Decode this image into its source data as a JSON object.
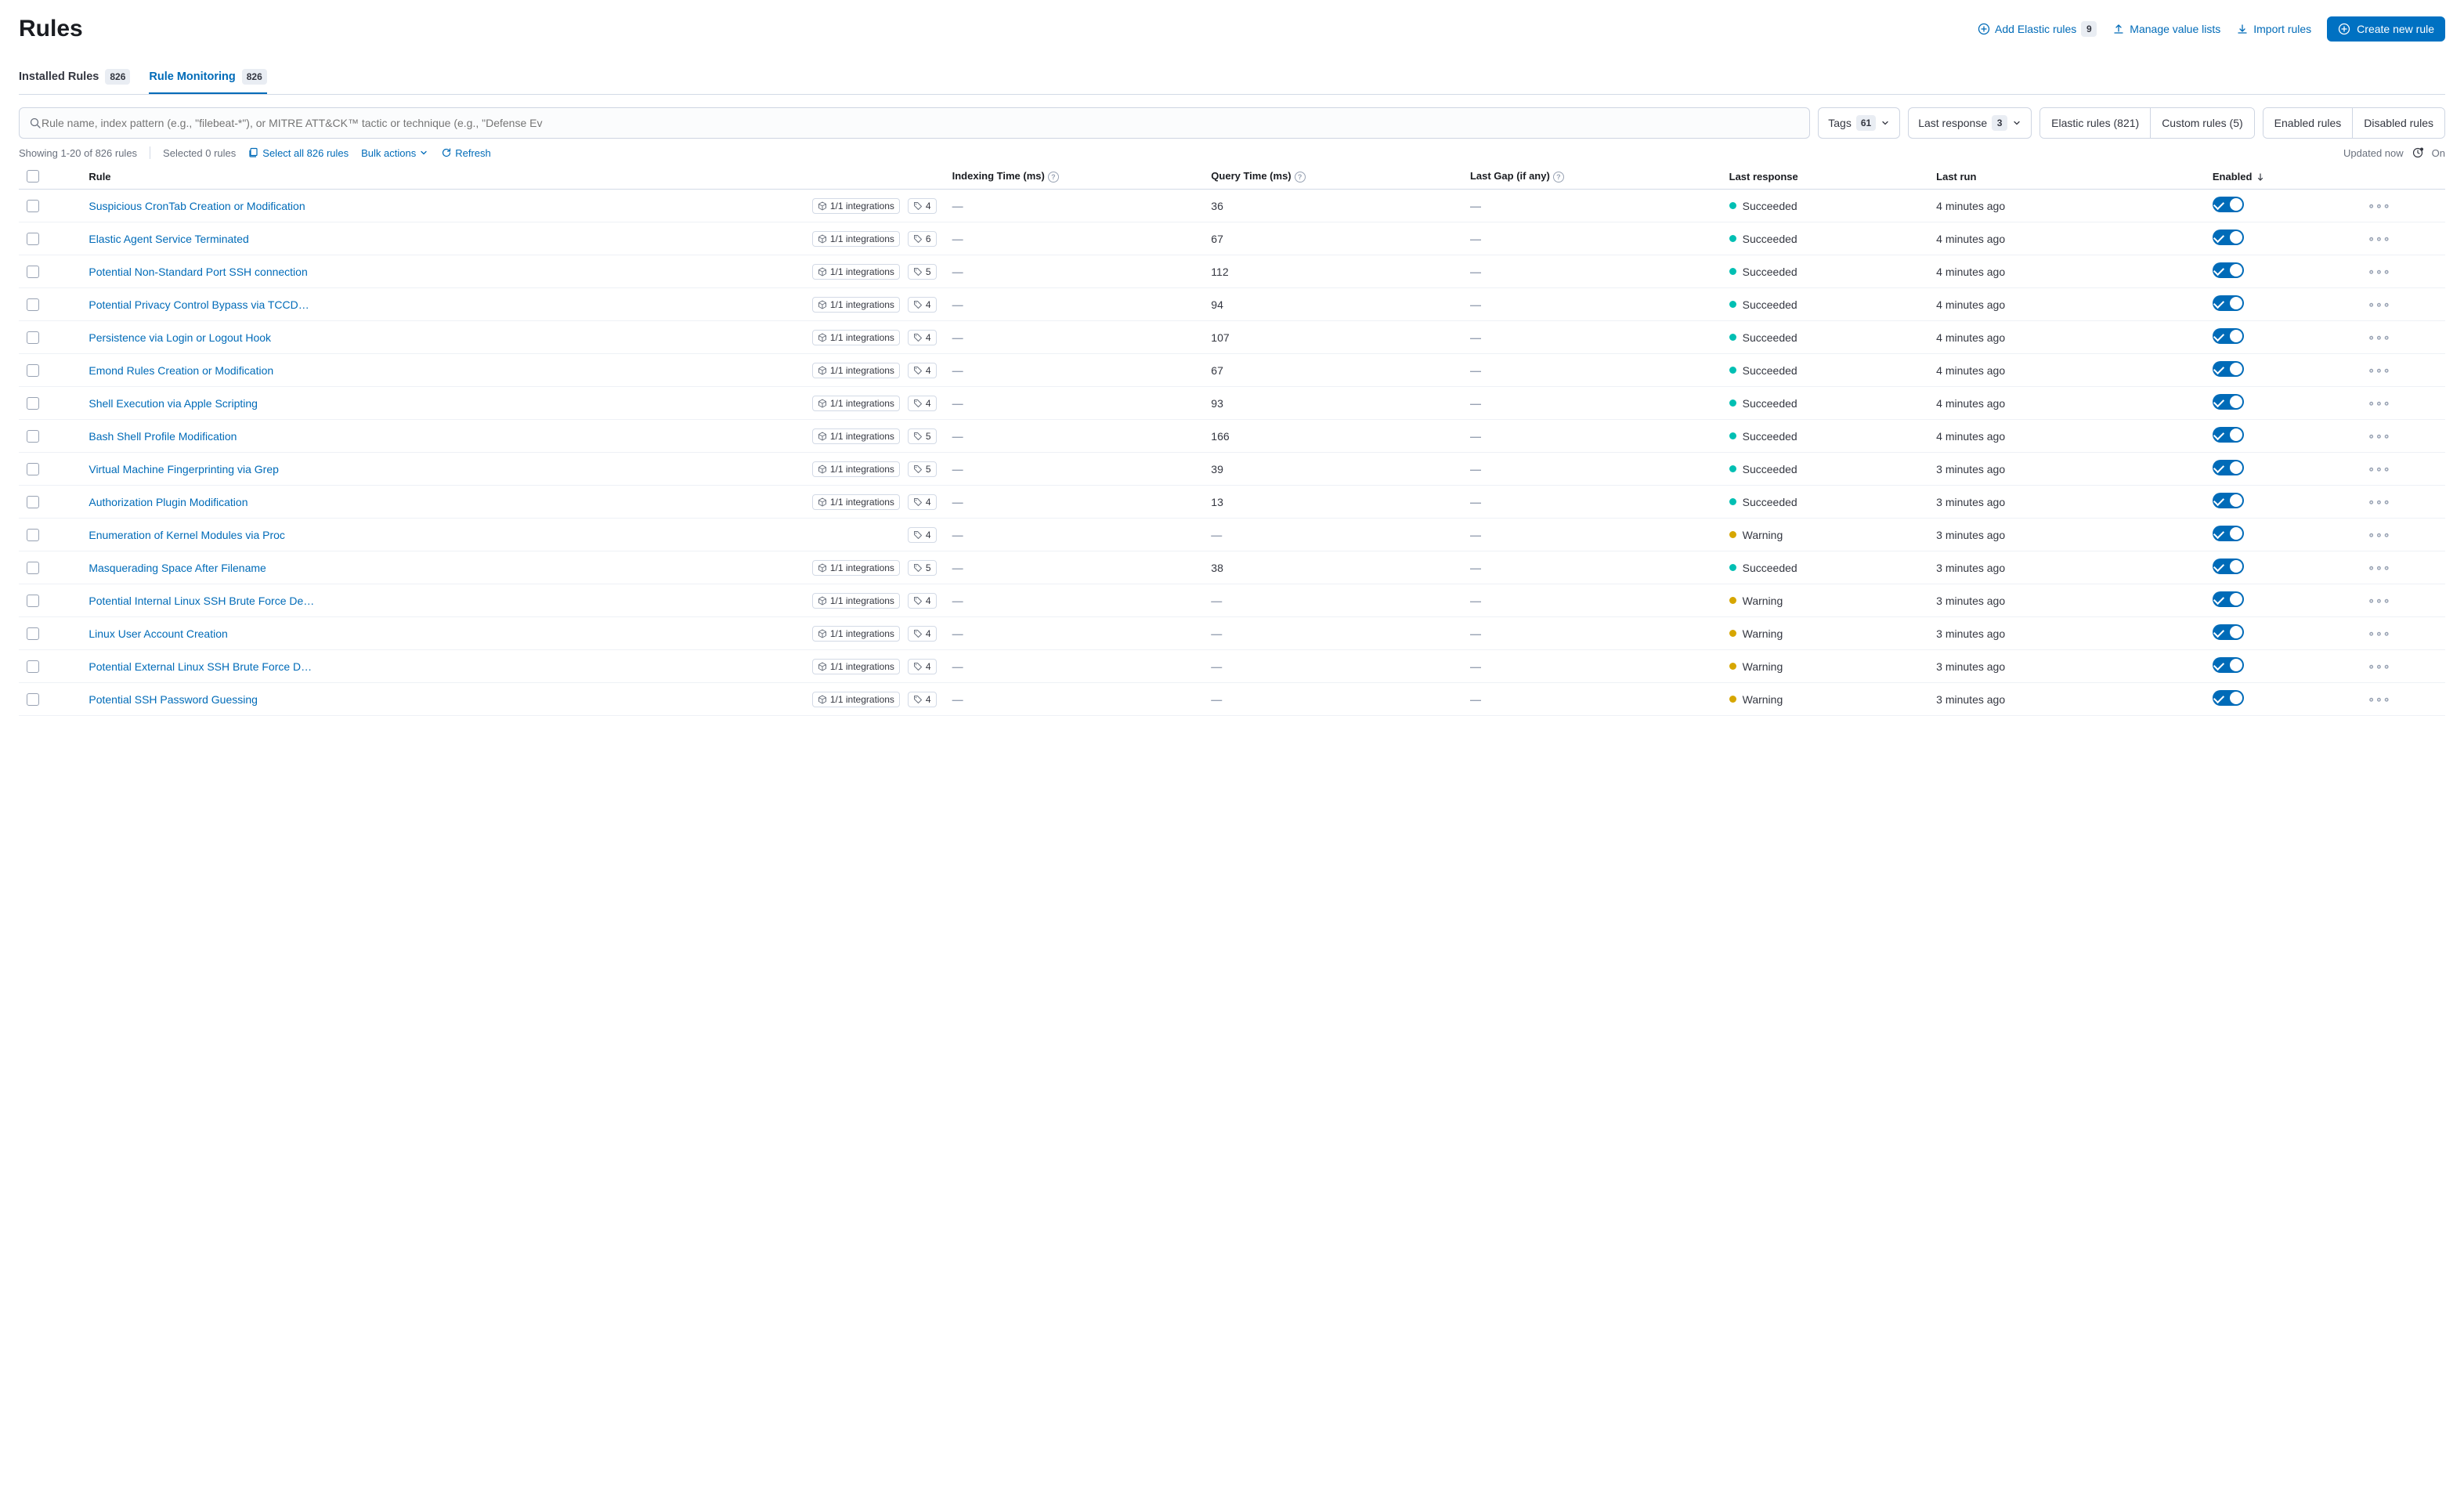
{
  "page": {
    "title": "Rules"
  },
  "header": {
    "add_rules": "Add Elastic rules",
    "add_rules_count": "9",
    "manage_value_lists": "Manage value lists",
    "import_rules": "Import rules",
    "create_rule": "Create new rule"
  },
  "tabs": {
    "installed": {
      "label": "Installed Rules",
      "count": "826"
    },
    "monitoring": {
      "label": "Rule Monitoring",
      "count": "826"
    }
  },
  "filters": {
    "search_placeholder": "Rule name, index pattern (e.g., \"filebeat-*\"), or MITRE ATT&CK™ tactic or technique (e.g., \"Defense Ev",
    "tags_label": "Tags",
    "tags_count": "61",
    "last_response_label": "Last response",
    "last_response_count": "3",
    "elastic_rules": "Elastic rules (821)",
    "custom_rules": "Custom rules (5)",
    "enabled_rules": "Enabled rules",
    "disabled_rules": "Disabled rules"
  },
  "toolbar": {
    "showing": "Showing 1-20 of 826 rules",
    "selected": "Selected 0 rules",
    "select_all": "Select all 826 rules",
    "bulk_actions": "Bulk actions",
    "refresh": "Refresh",
    "updated": "Updated now",
    "auto_label": "On"
  },
  "columns": {
    "rule": "Rule",
    "indexing_time": "Indexing Time (ms)",
    "query_time": "Query Time (ms)",
    "last_gap": "Last Gap (if any)",
    "last_response": "Last response",
    "last_run": "Last run",
    "enabled": "Enabled"
  },
  "rows": [
    {
      "name": "Suspicious CronTab Creation or Modification",
      "integrations": "1/1 integrations",
      "tags": "4",
      "indexing": "—",
      "query": "36",
      "gap": "—",
      "response": "Succeeded",
      "response_kind": "succeeded",
      "last_run": "4 minutes ago",
      "enabled": true
    },
    {
      "name": "Elastic Agent Service Terminated",
      "integrations": "1/1 integrations",
      "tags": "6",
      "indexing": "—",
      "query": "67",
      "gap": "—",
      "response": "Succeeded",
      "response_kind": "succeeded",
      "last_run": "4 minutes ago",
      "enabled": true
    },
    {
      "name": "Potential Non-Standard Port SSH connection",
      "integrations": "1/1 integrations",
      "tags": "5",
      "indexing": "—",
      "query": "112",
      "gap": "—",
      "response": "Succeeded",
      "response_kind": "succeeded",
      "last_run": "4 minutes ago",
      "enabled": true
    },
    {
      "name": "Potential Privacy Control Bypass via TCCDB…",
      "integrations": "1/1 integrations",
      "tags": "4",
      "indexing": "—",
      "query": "94",
      "gap": "—",
      "response": "Succeeded",
      "response_kind": "succeeded",
      "last_run": "4 minutes ago",
      "enabled": true
    },
    {
      "name": "Persistence via Login or Logout Hook",
      "integrations": "1/1 integrations",
      "tags": "4",
      "indexing": "—",
      "query": "107",
      "gap": "—",
      "response": "Succeeded",
      "response_kind": "succeeded",
      "last_run": "4 minutes ago",
      "enabled": true
    },
    {
      "name": "Emond Rules Creation or Modification",
      "integrations": "1/1 integrations",
      "tags": "4",
      "indexing": "—",
      "query": "67",
      "gap": "—",
      "response": "Succeeded",
      "response_kind": "succeeded",
      "last_run": "4 minutes ago",
      "enabled": true
    },
    {
      "name": "Shell Execution via Apple Scripting",
      "integrations": "1/1 integrations",
      "tags": "4",
      "indexing": "—",
      "query": "93",
      "gap": "—",
      "response": "Succeeded",
      "response_kind": "succeeded",
      "last_run": "4 minutes ago",
      "enabled": true
    },
    {
      "name": "Bash Shell Profile Modification",
      "integrations": "1/1 integrations",
      "tags": "5",
      "indexing": "—",
      "query": "166",
      "gap": "—",
      "response": "Succeeded",
      "response_kind": "succeeded",
      "last_run": "4 minutes ago",
      "enabled": true
    },
    {
      "name": "Virtual Machine Fingerprinting via Grep",
      "integrations": "1/1 integrations",
      "tags": "5",
      "indexing": "—",
      "query": "39",
      "gap": "—",
      "response": "Succeeded",
      "response_kind": "succeeded",
      "last_run": "3 minutes ago",
      "enabled": true
    },
    {
      "name": "Authorization Plugin Modification",
      "integrations": "1/1 integrations",
      "tags": "4",
      "indexing": "—",
      "query": "13",
      "gap": "—",
      "response": "Succeeded",
      "response_kind": "succeeded",
      "last_run": "3 minutes ago",
      "enabled": true
    },
    {
      "name": "Enumeration of Kernel Modules via Proc",
      "integrations": "",
      "tags": "4",
      "indexing": "—",
      "query": "—",
      "gap": "—",
      "response": "Warning",
      "response_kind": "warning",
      "last_run": "3 minutes ago",
      "enabled": true
    },
    {
      "name": "Masquerading Space After Filename",
      "integrations": "1/1 integrations",
      "tags": "5",
      "indexing": "—",
      "query": "38",
      "gap": "—",
      "response": "Succeeded",
      "response_kind": "succeeded",
      "last_run": "3 minutes ago",
      "enabled": true
    },
    {
      "name": "Potential Internal Linux SSH Brute Force Det…",
      "integrations": "1/1 integrations",
      "tags": "4",
      "indexing": "—",
      "query": "—",
      "gap": "—",
      "response": "Warning",
      "response_kind": "warning",
      "last_run": "3 minutes ago",
      "enabled": true
    },
    {
      "name": "Linux User Account Creation",
      "integrations": "1/1 integrations",
      "tags": "4",
      "indexing": "—",
      "query": "—",
      "gap": "—",
      "response": "Warning",
      "response_kind": "warning",
      "last_run": "3 minutes ago",
      "enabled": true
    },
    {
      "name": "Potential External Linux SSH Brute Force De…",
      "integrations": "1/1 integrations",
      "tags": "4",
      "indexing": "—",
      "query": "—",
      "gap": "—",
      "response": "Warning",
      "response_kind": "warning",
      "last_run": "3 minutes ago",
      "enabled": true
    },
    {
      "name": "Potential SSH Password Guessing",
      "integrations": "1/1 integrations",
      "tags": "4",
      "indexing": "—",
      "query": "—",
      "gap": "—",
      "response": "Warning",
      "response_kind": "warning",
      "last_run": "3 minutes ago",
      "enabled": true
    }
  ]
}
